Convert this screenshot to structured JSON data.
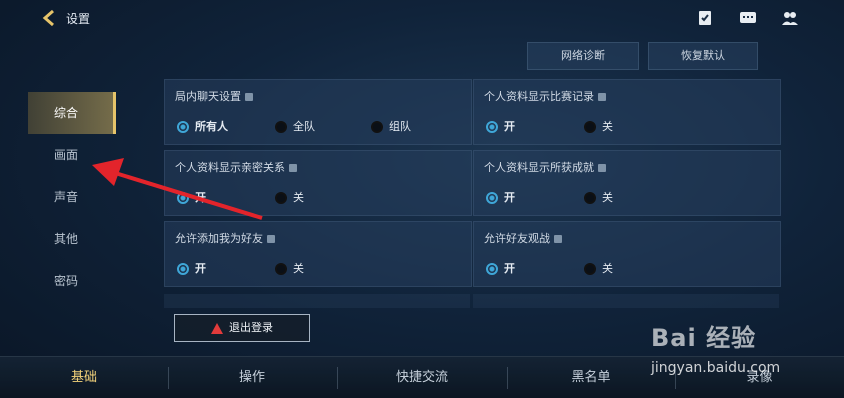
{
  "header": {
    "title": "设置",
    "buttons": [
      "网络诊断",
      "恢复默认"
    ]
  },
  "leftnav": {
    "items": [
      "综合",
      "画面",
      "声音",
      "其他",
      "密码"
    ]
  },
  "panels": {
    "p1": {
      "title": "局内聊天设置",
      "opts": [
        "所有人",
        "全队",
        "组队"
      ]
    },
    "p2": {
      "title": "个人资料显示比赛记录",
      "opts": [
        "开",
        "关"
      ]
    },
    "p3": {
      "title": "个人资料显示亲密关系",
      "opts": [
        "开",
        "关"
      ]
    },
    "p4": {
      "title": "个人资料显示所获成就",
      "opts": [
        "开",
        "关"
      ]
    },
    "p5": {
      "title": "允许添加我为好友",
      "opts": [
        "开",
        "关"
      ]
    },
    "p6": {
      "title": "允许好友观战",
      "opts": [
        "开",
        "关"
      ]
    }
  },
  "logout": {
    "label": "退出登录"
  },
  "bottom_tabs": [
    "基础",
    "操作",
    "快捷交流",
    "黑名单",
    "录像"
  ],
  "watermark": {
    "big": "Bai 经验",
    "small": "jingyan.baidu.com"
  },
  "colors": {
    "accent": "#3fa7d8",
    "active_gold": "#e6c46a",
    "arrow": "#e3242b"
  }
}
